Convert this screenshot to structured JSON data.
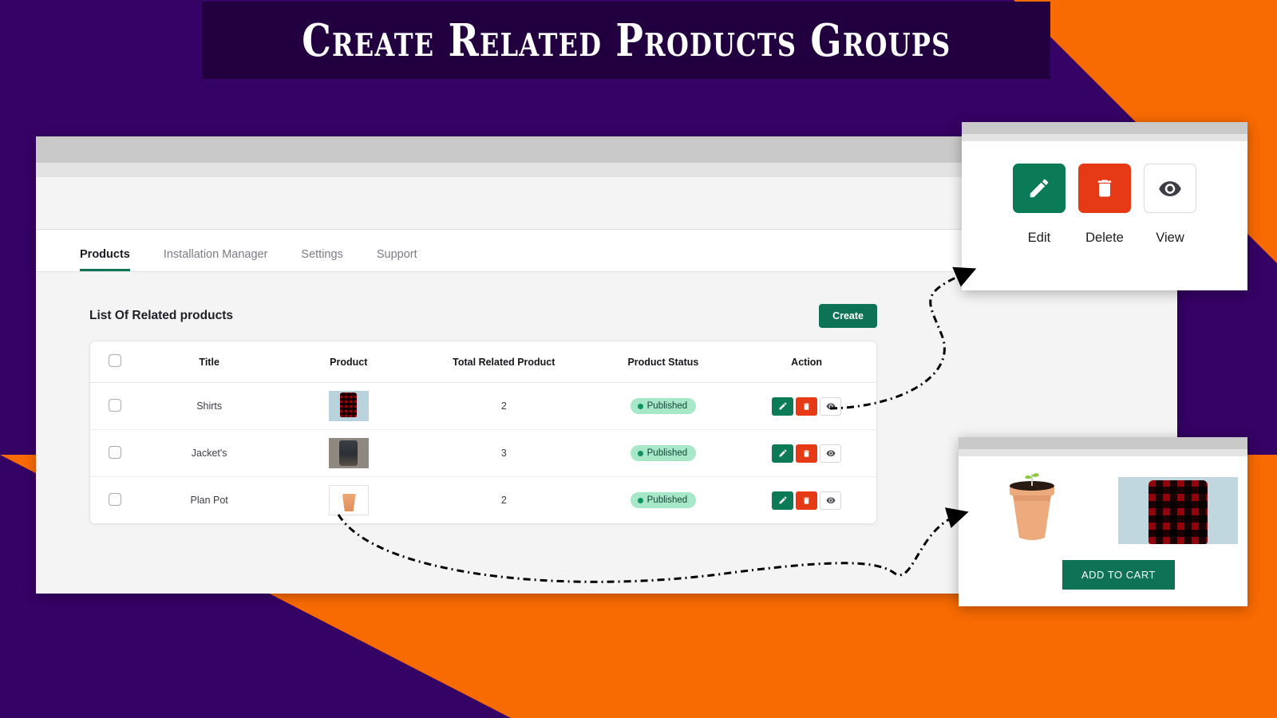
{
  "banner": {
    "title": "Create Related Products Groups",
    "background_color": "#22003f",
    "page_background_color": "#350265",
    "accent_color": "#f86a02"
  },
  "app": {
    "tabs": [
      {
        "label": "Products",
        "active": true
      },
      {
        "label": "Installation Manager",
        "active": false
      },
      {
        "label": "Settings",
        "active": false
      },
      {
        "label": "Support",
        "active": false
      }
    ],
    "list_title": "List Of Related products",
    "create_label": "Create",
    "accent_green": "#0e7254",
    "danger_red": "#e63a17"
  },
  "table": {
    "columns": [
      "",
      "Title",
      "Product",
      "Total Related Product",
      "Product Status",
      "Action"
    ],
    "rows": [
      {
        "title": "Shirts",
        "product_thumb": "shirt-thumbnail",
        "total_related": "2",
        "status": "Published",
        "actions": [
          "edit-icon",
          "delete-icon",
          "view-icon"
        ]
      },
      {
        "title": "Jacket's",
        "product_thumb": "jacket-thumbnail",
        "total_related": "3",
        "status": "Published",
        "actions": [
          "edit-icon",
          "delete-icon",
          "view-icon"
        ]
      },
      {
        "title": "Plan Pot",
        "product_thumb": "plant-pot-thumbnail",
        "total_related": "2",
        "status": "Published",
        "actions": [
          "edit-icon",
          "delete-icon",
          "view-icon"
        ]
      }
    ]
  },
  "callout_actions": {
    "buttons": [
      {
        "icon": "pencil-icon",
        "label": "Edit",
        "color": "#0b7a56"
      },
      {
        "icon": "trash-icon",
        "label": "Delete",
        "color": "#e63a17"
      },
      {
        "icon": "eye-icon",
        "label": "View",
        "color": "#ffffff"
      }
    ]
  },
  "callout_preview": {
    "items": [
      "plant-pot-image",
      "plaid-shirt-image"
    ],
    "add_to_cart_label": "ADD TO CART",
    "button_color": "#0e7254"
  }
}
